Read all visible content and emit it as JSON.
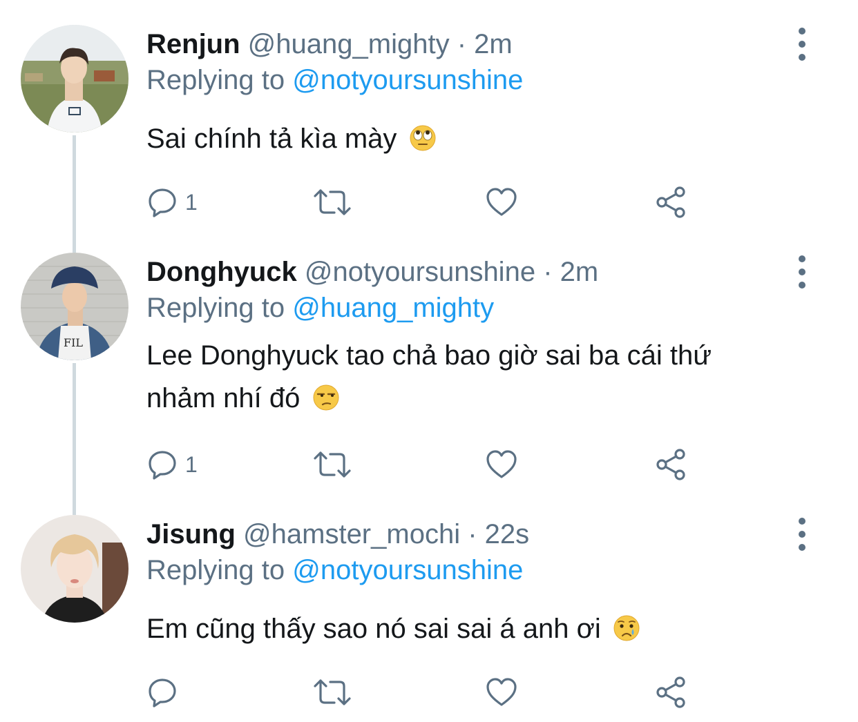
{
  "colors": {
    "text_primary": "#14171a",
    "text_secondary": "#5b7083",
    "link": "#1d9bf0",
    "thread_line": "#cfd9de"
  },
  "tweets": [
    {
      "display_name": "Renjun",
      "handle": "@huang_mighty",
      "separator": "·",
      "time": "2m",
      "replying_prefix": "Replying to",
      "replying_to": "@notyoursunshine",
      "text_lines": [
        "Sai chính tả kìa mày"
      ],
      "emoji": "face-with-rolling-eyes-emoji",
      "reply_count": "1",
      "avatar": "profile-photo-outdoor"
    },
    {
      "display_name": "Donghyuck",
      "handle": "@notyoursunshine",
      "separator": "·",
      "time": "2m",
      "replying_prefix": "Replying to",
      "replying_to": "@huang_mighty",
      "text_lines": [
        "Lee Donghyuck tao chả bao giờ sai ba cái thứ",
        "nhảm nhí đó"
      ],
      "emoji": "unamused-face-emoji",
      "reply_count": "1",
      "avatar": "profile-photo-bucket-hat"
    },
    {
      "display_name": "Jisung",
      "handle": "@hamster_mochi",
      "separator": "·",
      "time": "22s",
      "replying_prefix": "Replying to",
      "replying_to": "@notyoursunshine",
      "text_lines": [
        "Em cũng thấy sao nó sai sai á anh ơi"
      ],
      "emoji": "crying-face-emoji",
      "reply_count": "",
      "avatar": "profile-photo-blond"
    }
  ]
}
